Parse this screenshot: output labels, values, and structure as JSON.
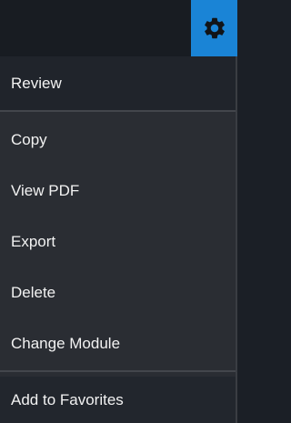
{
  "header": {
    "settings_icon": "gear-icon",
    "accent_color": "#1a84d6"
  },
  "menu": {
    "items": [
      {
        "label": "Review"
      },
      {
        "label": "Copy"
      },
      {
        "label": "View PDF"
      },
      {
        "label": "Export"
      },
      {
        "label": "Delete"
      },
      {
        "label": "Change Module"
      },
      {
        "label": "Add to Favorites"
      }
    ]
  }
}
